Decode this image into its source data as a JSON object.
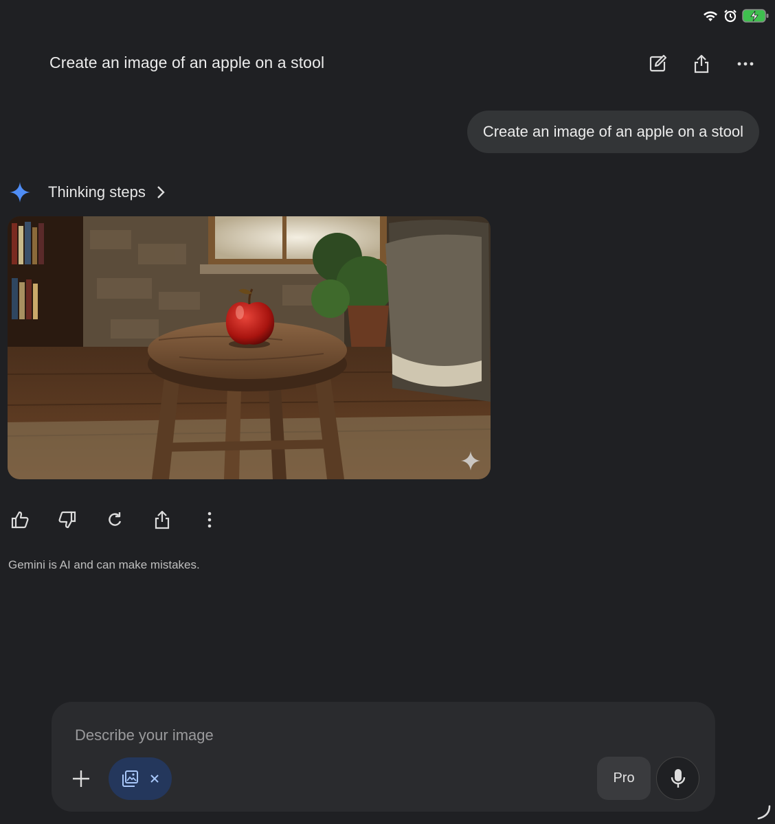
{
  "header": {
    "title": "Create an image of an apple on a stool"
  },
  "conversation": {
    "user_prompt": "Create an image of an apple on a stool",
    "thinking_label": "Thinking steps"
  },
  "footer": {
    "disclaimer": "Gemini is AI and can make mistakes."
  },
  "composer": {
    "placeholder": "Describe your image",
    "model_label": "Pro"
  },
  "icons": {
    "header": [
      "edit-icon",
      "share-icon",
      "more-horizontal-icon"
    ],
    "actions": [
      "thumb-up-icon",
      "thumb-down-icon",
      "regenerate-icon",
      "share-icon",
      "more-vertical-icon"
    ],
    "composer": [
      "plus-icon",
      "image-create-icon",
      "close-icon",
      "mic-icon"
    ]
  },
  "colors": {
    "background": "#1f2023",
    "bubble": "#333537",
    "composer": "#2a2b2e",
    "chip": "#24375c",
    "accent": "#4f8df5"
  }
}
